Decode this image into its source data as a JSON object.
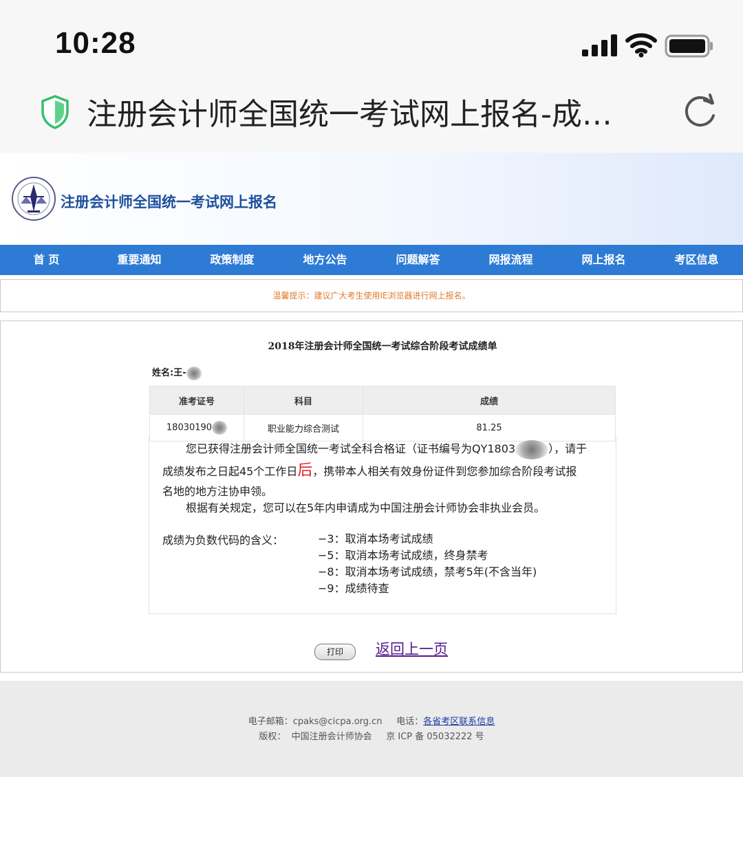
{
  "status_bar": {
    "time": "10:28"
  },
  "browser": {
    "page_title": "注册会计师全国统一考试网上报名-成…"
  },
  "site": {
    "name": "注册会计师全国统一考试网上报名"
  },
  "nav": {
    "items": [
      "首 页",
      "重要通知",
      "政策制度",
      "地方公告",
      "问题解答",
      "网报流程",
      "网上报名",
      "考区信息"
    ]
  },
  "notice": {
    "text": "温馨提示：建议广大考生使用IE浏览器进行网上报名。"
  },
  "report": {
    "title": "2018年注册会计师全国统一考试综合阶段考试成绩单",
    "name_label": "姓名:王-",
    "columns": [
      "准考证号",
      "科目",
      "成绩"
    ],
    "row": {
      "exam_no": "18030190",
      "subject": "职业能力综合测试",
      "score": "81.25"
    },
    "cert_line1_a": "您已获得注册会计师全国统一考试全科合格证（证书编号为QY1803",
    "cert_line1_b": "），请于",
    "cert_line2_a": "成绩发布之日起45个工作日",
    "cert_line2_big": "后",
    "cert_line2_b": "，携带本人相关有效身份证件到您参加综合阶段考试报",
    "cert_line3": "名地的地方注协申领。",
    "member_line": "根据有关规定，您可以在5年内申请成为中国注册会计师协会非执业会员。",
    "codes_label": "成绩为负数代码的含义：",
    "codes": [
      "−3：取消本场考试成绩",
      "−5：取消本场考试成绩，终身禁考",
      "−8：取消本场考试成绩，禁考5年(不含当年)",
      "−9：成绩待查"
    ]
  },
  "actions": {
    "print": "打印",
    "back": "返回上一页"
  },
  "footer": {
    "email_label": "电子邮箱：cpaks@cicpa.org.cn",
    "phone_label": "电话：",
    "phone_link": "各省考区联系信息",
    "copyright": "版权：  中国注册会计师协会     京 ICP 备 05032222 号"
  },
  "colors": {
    "nav": "#2e7bd6",
    "notice": "#e07a2c",
    "site_name": "#1d4f9c",
    "shield": "#35c06b"
  }
}
